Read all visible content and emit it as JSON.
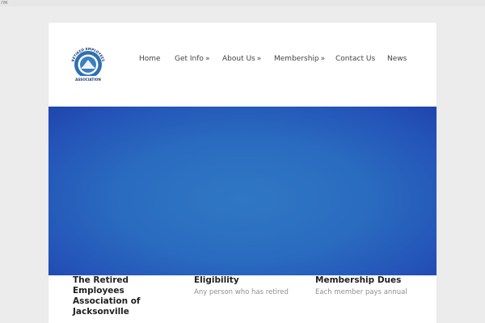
{
  "browser": {
    "tab_glyph": "กพ"
  },
  "logo": {
    "ring_text_top": "RETIRED EMPLOYEES",
    "ring_text_bottom": "ASSOCIATION"
  },
  "nav": {
    "items": [
      {
        "label": "Home",
        "has_submenu": false
      },
      {
        "label": "Get Info",
        "has_submenu": true
      },
      {
        "label": "About Us",
        "has_submenu": true
      },
      {
        "label": "Membership",
        "has_submenu": true
      },
      {
        "label": "Contact Us",
        "has_submenu": false
      },
      {
        "label": "News",
        "has_submenu": false
      }
    ],
    "submenu_arrow": "»"
  },
  "hero": {
    "colors": {
      "center": "#2f78c4",
      "edge": "#1f45ad"
    }
  },
  "columns": [
    {
      "title": "The Retired Employees Association of Jacksonville",
      "text": ""
    },
    {
      "title": "Eligibility",
      "text": "Any person who has retired"
    },
    {
      "title": "Membership Dues",
      "text": "Each member pays annual"
    }
  ]
}
